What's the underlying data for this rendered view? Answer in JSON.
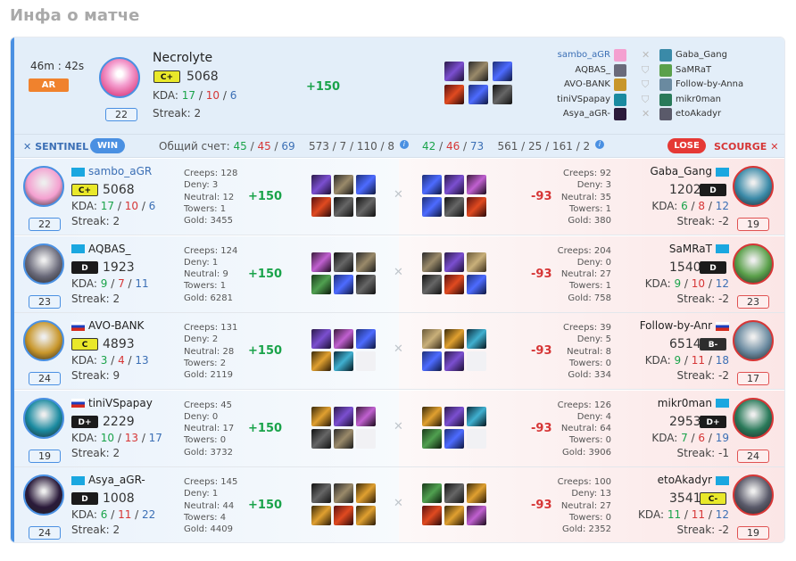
{
  "page": {
    "title": "Инфа о матче"
  },
  "summary": {
    "duration": "46m : 42s",
    "mode": "AR",
    "hero": "Necrolyte",
    "rank": "C+",
    "mmr": "5068",
    "kda_label": "KDA:",
    "kills": "17",
    "deaths": "10",
    "assists": "6",
    "streak": "Streak: 2",
    "level": "22",
    "points": "+150",
    "sentinel_roster": [
      "sambo_aGR",
      "AQBAS_",
      "AVO-BANK",
      "tiniVSpapay",
      "Asya_aGR-"
    ],
    "scourge_roster": [
      "Gaba_Gang",
      "SaMRaT",
      "Follow-by-Anna",
      "mikr0man",
      "etoAkadyr"
    ]
  },
  "teams": {
    "sentinel_label": "SENTINEL",
    "win_label": "WIN",
    "score_label": "Общий счет:",
    "sentinel_kills": "45",
    "sentinel_deaths": "45",
    "sentinel_assists": "69",
    "sentinel_farm": "573 / 7 / 110 / 8",
    "scourge_kills": "42",
    "scourge_deaths": "46",
    "scourge_assists": "73",
    "scourge_farm": "561 / 25 / 161 / 2",
    "lose_label": "LOSE",
    "scourge_label": "SCOURGE"
  },
  "sentinel": [
    {
      "name": "sambo_aGR",
      "flag": "kz",
      "rank": "C+",
      "rank_style": "y",
      "mmr": "5068",
      "k": "17",
      "d": "10",
      "a": "6",
      "streak": "Streak: 2",
      "level": "22",
      "creeps": "Creeps: 128",
      "deny": "Deny: 3",
      "neutral": "Neutral: 12",
      "towers": "Towers: 1",
      "gold": "Gold: 3455",
      "points": "+150"
    },
    {
      "name": "AQBAS_",
      "flag": "kz",
      "rank": "D",
      "rank_style": "r",
      "mmr": "1923",
      "k": "9",
      "d": "7",
      "a": "11",
      "streak": "Streak: 2",
      "level": "23",
      "creeps": "Creeps: 124",
      "deny": "Deny: 1",
      "neutral": "Neutral: 9",
      "towers": "Towers: 1",
      "gold": "Gold: 6281",
      "points": "+150"
    },
    {
      "name": "AVO-BANK",
      "flag": "ru",
      "rank": "C",
      "rank_style": "y",
      "mmr": "4893",
      "k": "3",
      "d": "4",
      "a": "13",
      "streak": "Streak: 9",
      "level": "24",
      "creeps": "Creeps: 131",
      "deny": "Deny: 2",
      "neutral": "Neutral: 28",
      "towers": "Towers: 2",
      "gold": "Gold: 2119",
      "points": "+150"
    },
    {
      "name": "tiniVSpapay",
      "flag": "ru",
      "rank": "D+",
      "rank_style": "r",
      "mmr": "2229",
      "k": "10",
      "d": "13",
      "a": "17",
      "streak": "Streak: 2",
      "level": "19",
      "creeps": "Creeps: 45",
      "deny": "Deny: 0",
      "neutral": "Neutral: 17",
      "towers": "Towers: 0",
      "gold": "Gold: 3732",
      "points": "+150"
    },
    {
      "name": "Asya_aGR-",
      "flag": "kz",
      "rank": "D",
      "rank_style": "r",
      "mmr": "1008",
      "k": "6",
      "d": "11",
      "a": "22",
      "streak": "Streak: 2",
      "level": "24",
      "creeps": "Creeps: 145",
      "deny": "Deny: 1",
      "neutral": "Neutral: 44",
      "towers": "Towers: 4",
      "gold": "Gold: 4409",
      "points": "+150"
    }
  ],
  "scourge": [
    {
      "name": "Gaba_Gang",
      "flag": "kz",
      "rank": "D",
      "rank_style": "r",
      "mmr": "1202",
      "k": "6",
      "d": "8",
      "a": "12",
      "streak": "Streak: -2",
      "level": "19",
      "creeps": "Creeps: 92",
      "deny": "Deny: 3",
      "neutral": "Neutral: 35",
      "towers": "Towers: 1",
      "gold": "Gold: 380",
      "points": "-93"
    },
    {
      "name": "SaMRaT",
      "flag": "kz",
      "rank": "D",
      "rank_style": "r",
      "mmr": "1540",
      "k": "9",
      "d": "10",
      "a": "12",
      "streak": "Streak: -2",
      "level": "23",
      "creeps": "Creeps: 204",
      "deny": "Deny: 0",
      "neutral": "Neutral: 27",
      "towers": "Towers: 1",
      "gold": "Gold: 758",
      "points": "-93"
    },
    {
      "name": "Follow-by-Anr",
      "flag": "ru",
      "rank": "B-",
      "rank_style": "w",
      "mmr": "6514",
      "k": "9",
      "d": "11",
      "a": "18",
      "streak": "Streak: -2",
      "level": "17",
      "creeps": "Creeps: 39",
      "deny": "Deny: 5",
      "neutral": "Neutral: 8",
      "towers": "Towers: 0",
      "gold": "Gold: 334",
      "points": "-93"
    },
    {
      "name": "mikr0man",
      "flag": "kz",
      "rank": "D+",
      "rank_style": "r",
      "mmr": "2953",
      "k": "7",
      "d": "6",
      "a": "19",
      "streak": "Streak: -1",
      "level": "24",
      "creeps": "Creeps: 126",
      "deny": "Deny: 4",
      "neutral": "Neutral: 64",
      "towers": "Towers: 0",
      "gold": "Gold: 3906",
      "points": "-93"
    },
    {
      "name": "etoAkadyr",
      "flag": "kz",
      "rank": "C-",
      "rank_style": "y",
      "mmr": "3541",
      "k": "11",
      "d": "11",
      "a": "12",
      "streak": "Streak: -2",
      "level": "19",
      "creeps": "Creeps: 100",
      "deny": "Deny: 13",
      "neutral": "Neutral: 27",
      "towers": "Towers: 0",
      "gold": "Gold: 2352",
      "points": "-93"
    }
  ]
}
